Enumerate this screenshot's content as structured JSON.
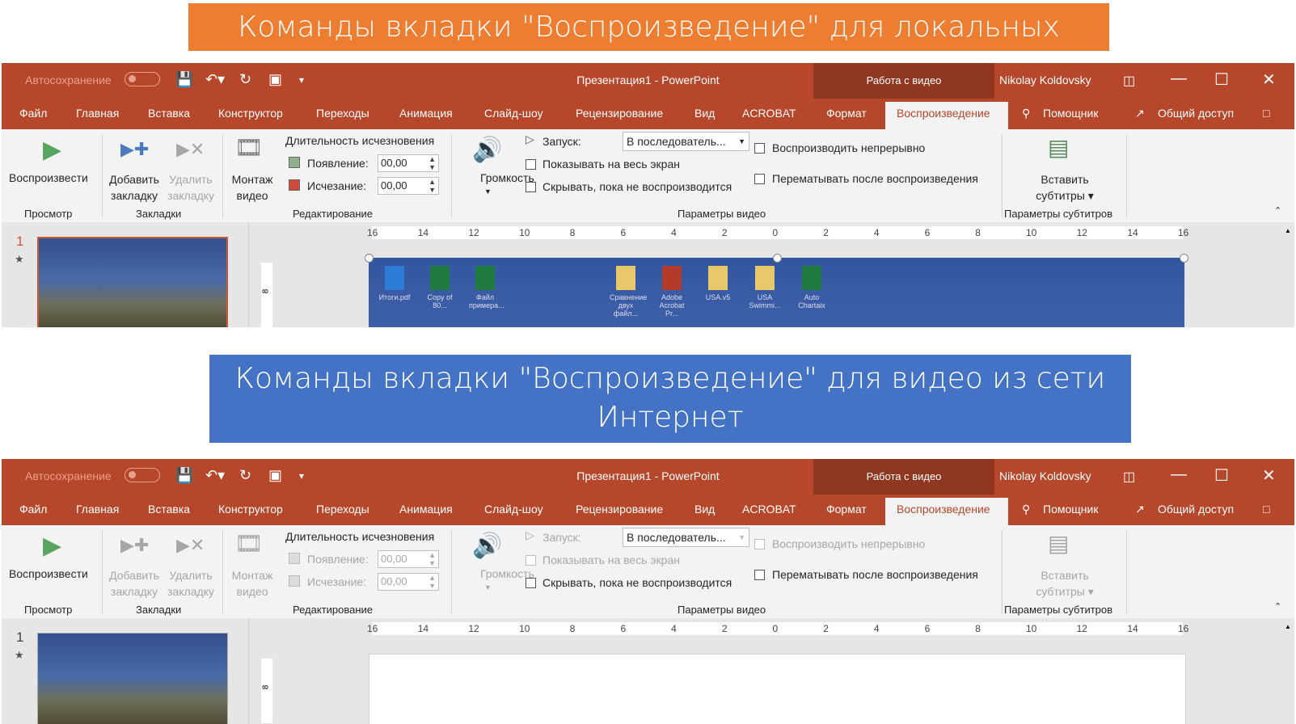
{
  "banners": {
    "local": "Команды вкладки \"Воспроизведение\" для локальных видео",
    "web_line1": "Команды вкладки \"Воспроизведение\" для видео из сети",
    "web_line2": "Интернет"
  },
  "app": {
    "autosave": "Автосохранение",
    "title": "Презентация1  -  PowerPoint",
    "context_group": "Работа с видео",
    "user": "Nikolay Koldovsky",
    "tabs": [
      "Файл",
      "Главная",
      "Вставка",
      "Конструктор",
      "Переходы",
      "Анимация",
      "Слайд-шоу",
      "Рецензирование",
      "Вид",
      "ACROBAT",
      "Формат",
      "Воспроизведение"
    ],
    "helper": "Помощник",
    "share": "Общий доступ"
  },
  "ribbon": {
    "play": "Воспроизвести",
    "add_bookmark": [
      "Добавить",
      "закладку"
    ],
    "remove_bookmark": [
      "Удалить",
      "закладку"
    ],
    "trim": [
      "Монтаж",
      "видео"
    ],
    "fade_duration": "Длительность исчезновения",
    "fade_in": "Появление:",
    "fade_out": "Исчезание:",
    "fade_in_value": "00,00",
    "fade_out_value": "00,00",
    "volume": "Громкость",
    "start": "Запуск:",
    "start_value": "В последователь...",
    "fullscreen": "Показывать на весь экран",
    "hide": "Скрывать, пока не воспроизводится",
    "loop": "Воспроизводить непрерывно",
    "rewind": "Перематывать после воспроизведения",
    "captions": [
      "Вставить",
      "субтитры"
    ],
    "groups": {
      "preview": "Просмотр",
      "bookmarks": "Закладки",
      "editing": "Редактирование",
      "video_options": "Параметры видео",
      "caption_options": "Параметры субтитров"
    }
  },
  "slides": {
    "number": "1",
    "star": "★"
  },
  "ruler": [
    "16",
    "14",
    "12",
    "10",
    "8",
    "6",
    "4",
    "2",
    "0",
    "2",
    "4",
    "6",
    "8",
    "10",
    "12",
    "14",
    "16"
  ],
  "vruler": "8",
  "desktop_icons": [
    {
      "label": "Итоги.pdf"
    },
    {
      "label": "Copy of 80..."
    },
    {
      "label": "Файл примера..."
    },
    {
      "label": "Сравнение двух файл..."
    },
    {
      "label": "Adobe Acrobat Pr..."
    },
    {
      "label": "USA.v5"
    },
    {
      "label": "USA Swimmi..."
    },
    {
      "label": "Auto Chartaix"
    }
  ],
  "colors": {
    "accent": "#b7472a",
    "context": "#8f3721",
    "orange_banner": "#ed7d31",
    "blue_banner": "#4472c4"
  }
}
